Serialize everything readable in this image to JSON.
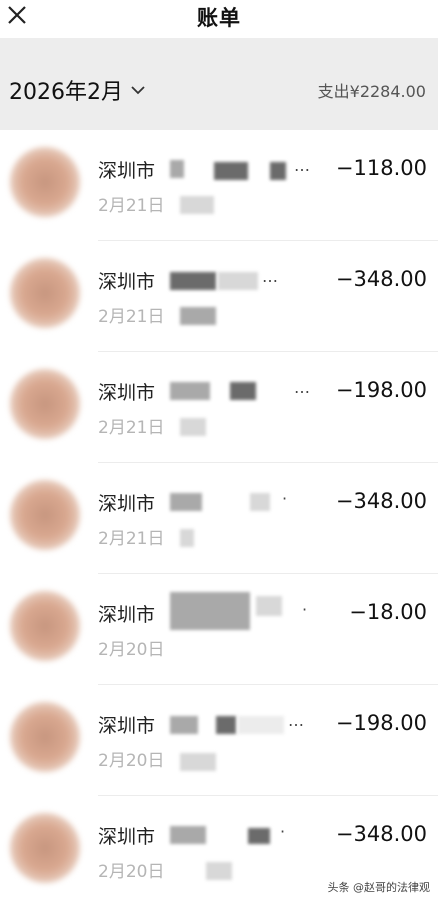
{
  "header": {
    "title": "账单",
    "close_icon": "close-icon"
  },
  "month": {
    "label": "2026年2月",
    "icon": "chevron-down-icon",
    "total": "支出¥2284.00"
  },
  "transactions": [
    {
      "merchant": "深圳市",
      "date": "2月21日",
      "amount": "−118.00"
    },
    {
      "merchant": "深圳市",
      "date": "2月21日",
      "amount": "−348.00"
    },
    {
      "merchant": "深圳市",
      "date": "2月21日",
      "amount": "−198.00"
    },
    {
      "merchant": "深圳市",
      "date": "2月21日",
      "amount": "−348.00"
    },
    {
      "merchant": "深圳市",
      "date": "2月20日",
      "amount": "−18.00"
    },
    {
      "merchant": "深圳市",
      "date": "2月20日",
      "amount": "−198.00"
    },
    {
      "merchant": "深圳市",
      "date": "2月20日",
      "amount": "−348.00"
    }
  ],
  "watermark": "头条 @赵哥的法律观"
}
